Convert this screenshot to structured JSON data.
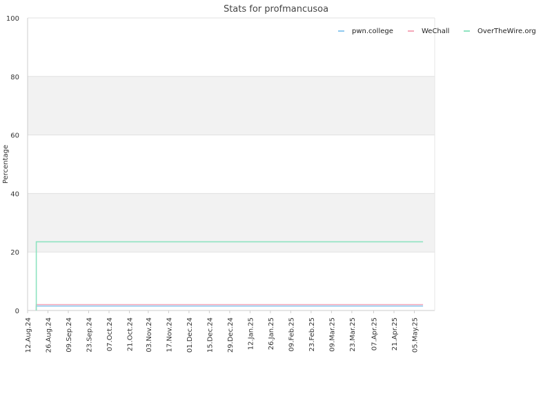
{
  "chart_data": {
    "type": "line",
    "title": "Stats for profmancusoa",
    "ylabel": "Percentage",
    "xlabel": "",
    "ylim": [
      0,
      100
    ],
    "xlim": [
      "2024-08-12",
      "2025-05-19"
    ],
    "yticks": [
      0,
      20,
      40,
      60,
      80,
      100
    ],
    "xtick_labels": [
      "12.Aug.24",
      "26.Aug.24",
      "09.Sep.24",
      "23.Sep.24",
      "07.Oct.24",
      "21.Oct.24",
      "03.Nov.24",
      "17.Nov.24",
      "01.Dec.24",
      "15.Dec.24",
      "29.Dec.24",
      "12.Jan.25",
      "26.Jan.25",
      "09.Feb.25",
      "23.Feb.25",
      "09.Mar.25",
      "23.Mar.25",
      "07.Apr.25",
      "21.Apr.25",
      "05.May.25"
    ],
    "xtick_dates": [
      "2024-08-12",
      "2024-08-26",
      "2024-09-09",
      "2024-09-23",
      "2024-10-07",
      "2024-10-21",
      "2024-11-03",
      "2024-11-17",
      "2024-12-01",
      "2024-12-15",
      "2024-12-29",
      "2025-01-12",
      "2025-01-26",
      "2025-02-09",
      "2025-02-23",
      "2025-03-09",
      "2025-03-23",
      "2025-04-07",
      "2025-04-21",
      "2025-05-05"
    ],
    "grid": true,
    "banded_background": true,
    "legend_position": "top-right",
    "series": [
      {
        "name": "pwn.college",
        "color": "#8ec9ef",
        "points": [
          [
            "2024-08-18",
            0
          ],
          [
            "2024-08-18",
            1.5
          ],
          [
            "2025-05-11",
            1.5
          ]
        ]
      },
      {
        "name": "WeChall",
        "color": "#f4a6b8",
        "points": [
          [
            "2024-08-18",
            0
          ],
          [
            "2024-08-18",
            2.0
          ],
          [
            "2025-05-11",
            2.0
          ]
        ]
      },
      {
        "name": "OverTheWire.org",
        "color": "#8de3c0",
        "points": [
          [
            "2024-08-18",
            0
          ],
          [
            "2024-08-18",
            23.5
          ],
          [
            "2025-05-11",
            23.5
          ]
        ]
      }
    ]
  }
}
